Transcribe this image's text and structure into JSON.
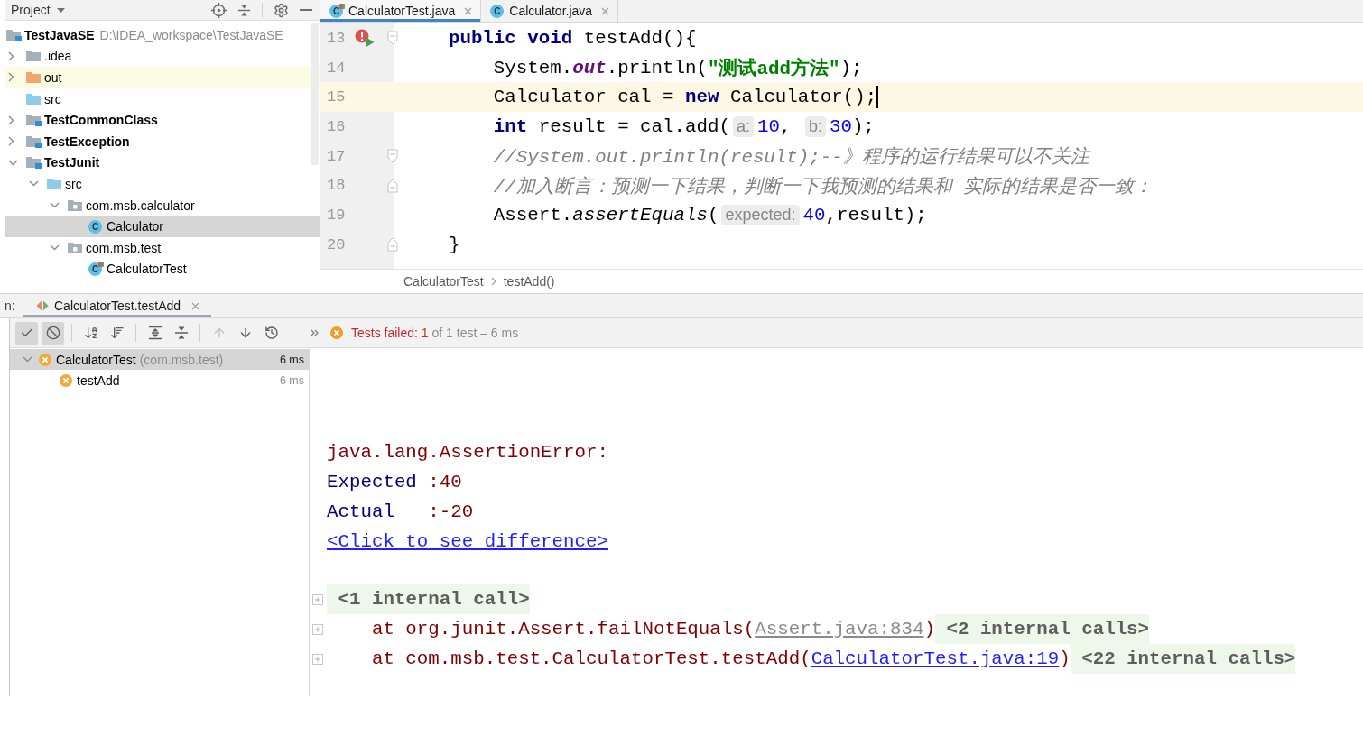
{
  "project_panel": {
    "title": "Project",
    "tree": [
      {
        "label": "TestJavaSE",
        "path": "D:\\IDEA_workspace\\TestJavaSE",
        "kind": "module",
        "selected": false,
        "highlighted": false,
        "children": [
          {
            "label": ".idea",
            "kind": "folder",
            "expanded": false,
            "selected": false,
            "highlighted": false
          },
          {
            "label": "out",
            "kind": "excluded_folder",
            "expanded": false,
            "selected": false,
            "highlighted": true
          },
          {
            "label": "src",
            "kind": "source_folder",
            "selected": false,
            "highlighted": false
          },
          {
            "label": "TestCommonClass",
            "kind": "module",
            "expanded": false,
            "selected": false,
            "highlighted": false
          },
          {
            "label": "TestException",
            "kind": "module",
            "expanded": false,
            "selected": false,
            "highlighted": false
          },
          {
            "label": "TestJunit",
            "kind": "module",
            "expanded": true,
            "selected": false,
            "highlighted": false,
            "children": [
              {
                "label": "src",
                "kind": "source_folder",
                "expanded": true,
                "selected": false,
                "highlighted": false,
                "children": [
                  {
                    "label": "com.msb.calculator",
                    "kind": "package",
                    "expanded": true,
                    "selected": false,
                    "highlighted": false,
                    "children": [
                      {
                        "label": "Calculator",
                        "kind": "class",
                        "icon_letter": "C",
                        "selected": true,
                        "highlighted": false
                      }
                    ]
                  },
                  {
                    "label": "com.msb.test",
                    "kind": "package",
                    "expanded": true,
                    "selected": false,
                    "highlighted": false,
                    "children": [
                      {
                        "label": "CalculatorTest",
                        "kind": "test_class",
                        "icon_letter": "C",
                        "selected": false,
                        "highlighted": false
                      }
                    ]
                  }
                ]
              }
            ]
          }
        ]
      }
    ]
  },
  "editor": {
    "tabs": [
      {
        "label": "CalculatorTest.java",
        "kind": "test_class",
        "icon_letter": "C",
        "selected": true
      },
      {
        "label": "Calculator.java",
        "kind": "class",
        "icon_letter": "C",
        "selected": false
      }
    ],
    "lines": [
      {
        "number": "13",
        "current": false,
        "fold_start": true,
        "fold_end": false,
        "run_failed": true,
        "tokens": [
          {
            "text": "    public",
            "kind": "keyword"
          },
          {
            "text": " void",
            "kind": "keyword"
          },
          {
            "text": " testAdd(){",
            "kind": "plain"
          }
        ]
      },
      {
        "number": "14",
        "current": false,
        "fold_start": false,
        "fold_end": false,
        "run_failed": false,
        "tokens": [
          {
            "text": "        System.",
            "kind": "plain"
          },
          {
            "text": "out",
            "kind": "field"
          },
          {
            "text": ".println(",
            "kind": "plain"
          },
          {
            "text": "\"测试add方法\"",
            "kind": "string"
          },
          {
            "text": ");",
            "kind": "plain"
          }
        ]
      },
      {
        "number": "15",
        "current": true,
        "fold_start": false,
        "fold_end": false,
        "run_failed": false,
        "tokens": [
          {
            "text": "        Calculator cal = ",
            "kind": "plain"
          },
          {
            "text": "new",
            "kind": "keyword"
          },
          {
            "text": " Calculator();",
            "kind": "plain"
          }
        ]
      },
      {
        "number": "16",
        "current": false,
        "fold_start": false,
        "fold_end": false,
        "run_failed": false,
        "tokens": [
          {
            "text": "        int",
            "kind": "keyword"
          },
          {
            "text": " result = cal.add(",
            "kind": "plain"
          },
          {
            "text": "a:",
            "kind": "hint"
          },
          {
            "text": "10",
            "kind": "number"
          },
          {
            "text": ", ",
            "kind": "plain"
          },
          {
            "text": "b:",
            "kind": "hint"
          },
          {
            "text": "30",
            "kind": "number"
          },
          {
            "text": ");",
            "kind": "plain"
          }
        ]
      },
      {
        "number": "17",
        "current": false,
        "fold_start": true,
        "fold_end": false,
        "run_failed": false,
        "tokens": [
          {
            "text": "        //System.out.println(result);--》程序的运行结果可以不关注",
            "kind": "comment"
          }
        ]
      },
      {
        "number": "18",
        "current": false,
        "fold_start": false,
        "fold_end": true,
        "run_failed": false,
        "tokens": [
          {
            "text": "        //加入断言：预测一下结果，判断一下我预测的结果和 实际的结果是否一致：",
            "kind": "comment"
          }
        ]
      },
      {
        "number": "19",
        "current": false,
        "fold_start": false,
        "fold_end": false,
        "run_failed": false,
        "tokens": [
          {
            "text": "        Assert.",
            "kind": "plain"
          },
          {
            "text": "assertEquals",
            "kind": "static_call"
          },
          {
            "text": "(",
            "kind": "plain"
          },
          {
            "text": "expected:",
            "kind": "hint"
          },
          {
            "text": "40",
            "kind": "number"
          },
          {
            "text": ",result);",
            "kind": "plain"
          }
        ]
      },
      {
        "number": "20",
        "current": false,
        "fold_start": false,
        "fold_end": true,
        "run_failed": false,
        "tokens": [
          {
            "text": "    }",
            "kind": "plain"
          }
        ]
      }
    ],
    "breadcrumbs": [
      "CalculatorTest",
      "testAdd()"
    ]
  },
  "run_panel": {
    "tool_window_label": "n:",
    "tabs": [
      {
        "label": "CalculatorTest.testAdd",
        "selected": true
      }
    ],
    "toolbar_buttons": [
      {
        "pressed": true,
        "disabled": false
      },
      {
        "pressed": true,
        "disabled": false
      },
      {
        "pressed": false,
        "disabled": false
      },
      {
        "pressed": false,
        "disabled": false
      },
      {
        "pressed": false,
        "disabled": false
      },
      {
        "pressed": false,
        "disabled": false
      },
      {
        "pressed": false,
        "disabled": true
      },
      {
        "pressed": false,
        "disabled": false
      },
      {
        "pressed": false,
        "disabled": false
      }
    ],
    "status": {
      "failed": "Tests failed: 1",
      "summary": "of 1 test – 6 ms"
    },
    "test_tree": [
      {
        "label": "CalculatorTest",
        "package": "(com.msb.test)",
        "duration": "6 ms",
        "failed": true,
        "expanded": true,
        "selected": true,
        "children": [
          {
            "label": "testAdd",
            "duration": "6 ms",
            "failed": true,
            "selected": false
          }
        ]
      }
    ],
    "output": {
      "message": [
        {
          "segments": [
            {
              "text": "java.lang.AssertionError:",
              "kind": "error"
            }
          ]
        },
        {
          "segments": [
            {
              "text": "Expected ",
              "kind": "label"
            },
            {
              "text": ":40",
              "kind": "error"
            }
          ]
        },
        {
          "segments": [
            {
              "text": "Actual   ",
              "kind": "label"
            },
            {
              "text": ":-20",
              "kind": "error"
            }
          ]
        },
        {
          "segments": [
            {
              "text": "<Click to see difference>",
              "kind": "link"
            }
          ]
        }
      ],
      "stack": [
        {
          "collapsed": true,
          "segments": [
            {
              "text": "<1 internal call>",
              "kind": "folded"
            }
          ]
        },
        {
          "collapsed": true,
          "segments": [
            {
              "text": "    at org.junit.Assert.failNotEquals(",
              "kind": "error"
            },
            {
              "text": "Assert.java:834",
              "kind": "muted_link"
            },
            {
              "text": ")",
              "kind": "error"
            },
            {
              "text": "<2 internal calls>",
              "kind": "folded"
            }
          ]
        },
        {
          "collapsed": true,
          "segments": [
            {
              "text": "    at com.msb.test.CalculatorTest.testAdd(",
              "kind": "error"
            },
            {
              "text": "CalculatorTest.java:19",
              "kind": "link"
            },
            {
              "text": ")",
              "kind": "error"
            },
            {
              "text": "<22 internal calls>",
              "kind": "folded"
            }
          ]
        }
      ]
    }
  }
}
